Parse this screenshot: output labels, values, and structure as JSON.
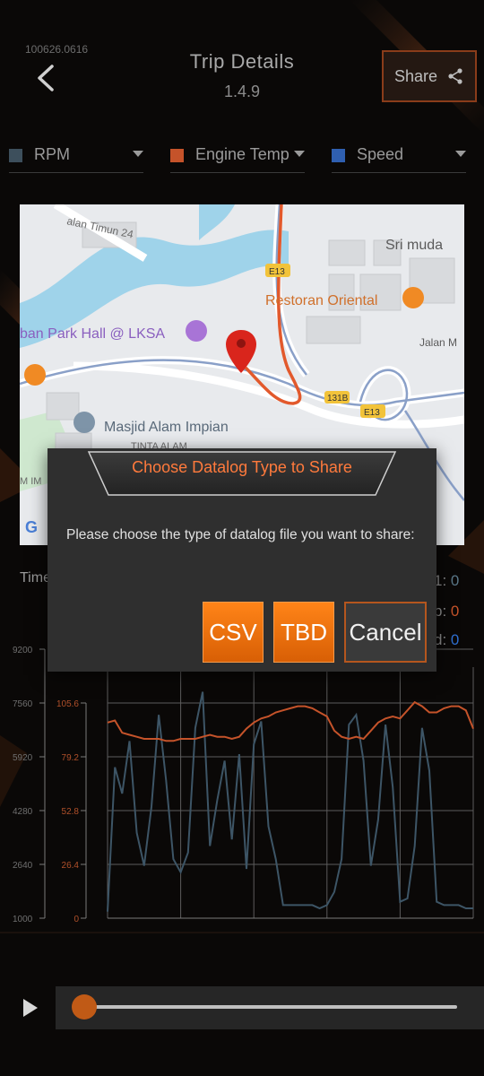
{
  "header": {
    "version_code": "100626.0616",
    "title": "Trip Details",
    "version": "1.4.9",
    "share_label": "Share"
  },
  "selectors": [
    {
      "label": "RPM",
      "color": "#3d4f5c"
    },
    {
      "label": "Engine Temp",
      "color": "#c5532a"
    },
    {
      "label": "Speed",
      "color": "#2f5fb0"
    }
  ],
  "map": {
    "labels": {
      "road_top": "alan Timun 24",
      "sri_muda": "Sri muda",
      "e13_top": "E13",
      "restoran": "Restoran Oriental",
      "park_hall": "ban Park Hall @ LKSA",
      "jalan_m": "Jalan M",
      "r131b": "131B",
      "e13_bottom": "E13",
      "masjid": "Masjid Alam Impian",
      "tinta": "TINTA ALAM",
      "m_im": "M IM",
      "google_g": "G"
    }
  },
  "readouts": {
    "time_label": "Time",
    "rpm_suffix": "1:",
    "rpm_value": "0",
    "temp_suffix": "p:",
    "temp_value": "0",
    "speed_suffix": "d:",
    "speed_value": "0"
  },
  "chart_data": {
    "type": "line",
    "y_left": {
      "ticks": [
        "9200",
        "7560",
        "5920",
        "4280",
        "2640",
        "1000"
      ],
      "range": [
        1000,
        9200
      ]
    },
    "y_temp": {
      "ticks": [
        "105.6",
        "79.2",
        "52.8",
        "26.4",
        "0"
      ],
      "range": [
        0,
        132
      ]
    },
    "x": [
      0,
      2,
      4,
      6,
      8,
      10,
      12,
      14,
      16,
      18,
      20,
      22,
      24,
      26,
      28,
      30,
      32,
      34,
      36,
      38,
      40,
      42,
      44,
      46,
      48,
      50,
      52,
      54,
      56,
      58,
      60,
      62,
      64,
      66,
      68,
      70,
      72,
      74,
      76,
      78,
      80,
      82,
      84,
      86,
      88,
      90,
      92,
      94,
      96,
      98,
      100
    ],
    "series": [
      {
        "color": "#3d5566",
        "values": [
          1200,
          5600,
          4800,
          6400,
          3600,
          2600,
          4400,
          7200,
          5200,
          2800,
          2400,
          3000,
          6800,
          7900,
          3200,
          4600,
          5800,
          3400,
          6000,
          2500,
          6300,
          7000,
          3800,
          2800,
          1400,
          1400,
          1400,
          1400,
          1400,
          1300,
          1400,
          1800,
          2800,
          6900,
          7200,
          5800,
          2600,
          4000,
          6900,
          5000,
          1500,
          1600,
          3200,
          6800,
          5500,
          1500,
          1400,
          1400,
          1400,
          1300,
          1300
        ]
      },
      {
        "color": "#c5532a",
        "values": [
          96,
          97,
          91,
          90,
          89,
          88,
          88,
          88,
          87,
          87,
          88,
          88,
          88,
          89,
          90,
          89,
          89,
          88,
          89,
          93,
          96,
          98,
          99,
          101,
          102,
          103,
          104,
          104,
          103,
          101,
          99,
          92,
          89,
          88,
          89,
          88,
          92,
          96,
          98,
          99,
          98,
          102,
          106,
          104,
          101,
          101,
          103,
          104,
          104,
          102,
          93
        ]
      }
    ]
  },
  "playback": {
    "progress": 0.0
  },
  "dialog": {
    "title": "Choose Datalog Type to Share",
    "message": "Please choose the type of datalog file you want to share:",
    "csv_label": "CSV",
    "tbd_label": "TBD",
    "cancel_label": "Cancel"
  }
}
